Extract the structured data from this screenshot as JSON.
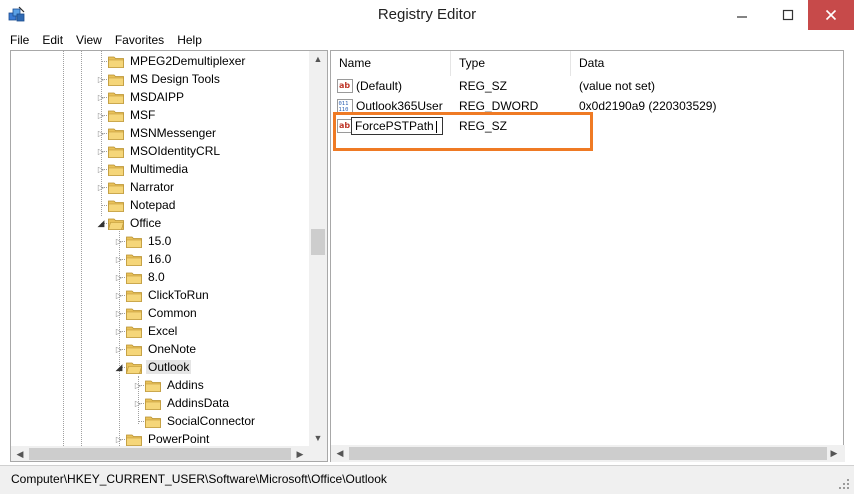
{
  "window": {
    "title": "Registry Editor"
  },
  "menu": [
    "File",
    "Edit",
    "View",
    "Favorites",
    "Help"
  ],
  "tree": [
    {
      "label": "MPEG2Demultiplexer",
      "level": 0,
      "state": "none"
    },
    {
      "label": "MS Design Tools",
      "level": 0,
      "state": "closed"
    },
    {
      "label": "MSDAIPP",
      "level": 0,
      "state": "closed"
    },
    {
      "label": "MSF",
      "level": 0,
      "state": "closed"
    },
    {
      "label": "MSNMessenger",
      "level": 0,
      "state": "closed"
    },
    {
      "label": "MSOIdentityCRL",
      "level": 0,
      "state": "closed"
    },
    {
      "label": "Multimedia",
      "level": 0,
      "state": "closed"
    },
    {
      "label": "Narrator",
      "level": 0,
      "state": "closed"
    },
    {
      "label": "Notepad",
      "level": 0,
      "state": "none"
    },
    {
      "label": "Office",
      "level": 0,
      "state": "open"
    },
    {
      "label": "15.0",
      "level": 1,
      "state": "closed"
    },
    {
      "label": "16.0",
      "level": 1,
      "state": "closed"
    },
    {
      "label": "8.0",
      "level": 1,
      "state": "closed"
    },
    {
      "label": "ClickToRun",
      "level": 1,
      "state": "closed"
    },
    {
      "label": "Common",
      "level": 1,
      "state": "closed"
    },
    {
      "label": "Excel",
      "level": 1,
      "state": "closed"
    },
    {
      "label": "OneNote",
      "level": 1,
      "state": "closed"
    },
    {
      "label": "Outlook",
      "level": 1,
      "state": "open",
      "selected": true
    },
    {
      "label": "Addins",
      "level": 2,
      "state": "closed"
    },
    {
      "label": "AddinsData",
      "level": 2,
      "state": "closed"
    },
    {
      "label": "SocialConnector",
      "level": 2,
      "state": "none"
    },
    {
      "label": "PowerPoint",
      "level": 1,
      "state": "closed"
    }
  ],
  "columns": {
    "name": "Name",
    "type": "Type",
    "data": "Data"
  },
  "values": [
    {
      "icon": "string-value-icon",
      "name": "(Default)",
      "type": "REG_SZ",
      "data": "(value not set)"
    },
    {
      "icon": "dword-value-icon",
      "name": "Outlook365User",
      "type": "REG_DWORD",
      "data": "0x0d2190a9 (220303529)"
    }
  ],
  "editing": {
    "icon": "string-value-icon",
    "name": "ForcePSTPath",
    "type": "REG_SZ",
    "data": ""
  },
  "status": {
    "path": "Computer\\HKEY_CURRENT_USER\\Software\\Microsoft\\Office\\Outlook"
  },
  "colors": {
    "highlight": "#ef7a24",
    "close_button": "#c74a4a",
    "folder": "#e8c15a"
  }
}
